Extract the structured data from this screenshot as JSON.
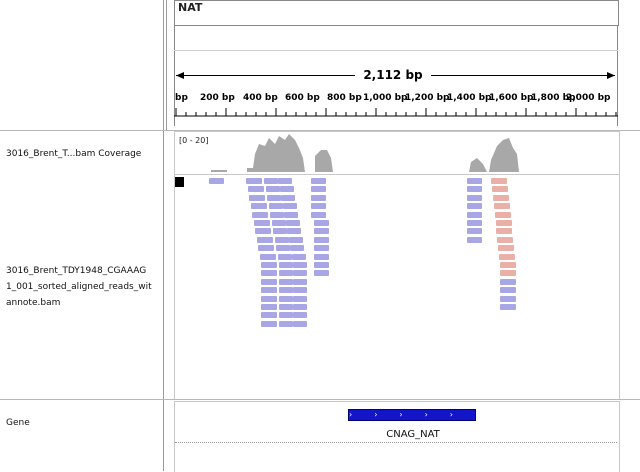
{
  "header": {
    "chromosome": "NAT",
    "span_label": "2,112 bp"
  },
  "ruler": {
    "tick_labels": [
      "bp",
      "200 bp",
      "400 bp",
      "600 bp",
      "800 bp",
      "1,000 bp",
      "1,200 bp",
      "1,400 bp",
      "1,600 bp",
      "1,800 bp",
      "2,000 bp"
    ]
  },
  "tracks": {
    "coverage": {
      "name": "3016_Brent_T...bam Coverage",
      "data_range": "[0 - 20]"
    },
    "alignments": {
      "name_lines": [
        "3016_Brent_TDY1948_CGAAAG",
        "1_001_sorted_aligned_reads_wit",
        "annote.bam"
      ]
    },
    "gene": {
      "name": "Gene",
      "feature_name": "CNAG_NAT",
      "strand_arrows": "›››››"
    }
  },
  "colors": {
    "forward_read": "#a9a6e6",
    "reverse_read": "#eab0a8",
    "coverage": "#a8a8a8",
    "gene": "#1414c8"
  }
}
